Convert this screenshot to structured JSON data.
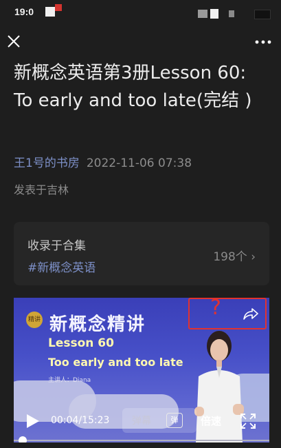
{
  "status_bar": {
    "time": "19:0"
  },
  "article": {
    "title": "新概念英语第3册Lesson 60: To early and too late(完结 )",
    "author": "王1号的书房",
    "date": "2022-11-06 07:38",
    "location": "发表于吉林"
  },
  "collection": {
    "label": "收录于合集",
    "tag": "#新概念英语",
    "count": "198个",
    "chevron": "›"
  },
  "video": {
    "cover_title": "新概念精讲",
    "badge": "精讲",
    "lesson": "Lesson 60",
    "subtitle": "Too early and too late",
    "presenter": "主讲人：Diana",
    "question_mark": "?",
    "time": "00:04/15:23",
    "danmu_label": "弹幕",
    "danmu_icon_label": "弹",
    "speed_label": "倍速",
    "progress": 0.004
  },
  "colors": {
    "accent": "#7d90c8",
    "annotation": "#e2322f"
  },
  "icons": [
    "close-icon",
    "more-icon",
    "share-icon",
    "play-icon",
    "fullscreen-icon",
    "chevron-right-icon"
  ]
}
